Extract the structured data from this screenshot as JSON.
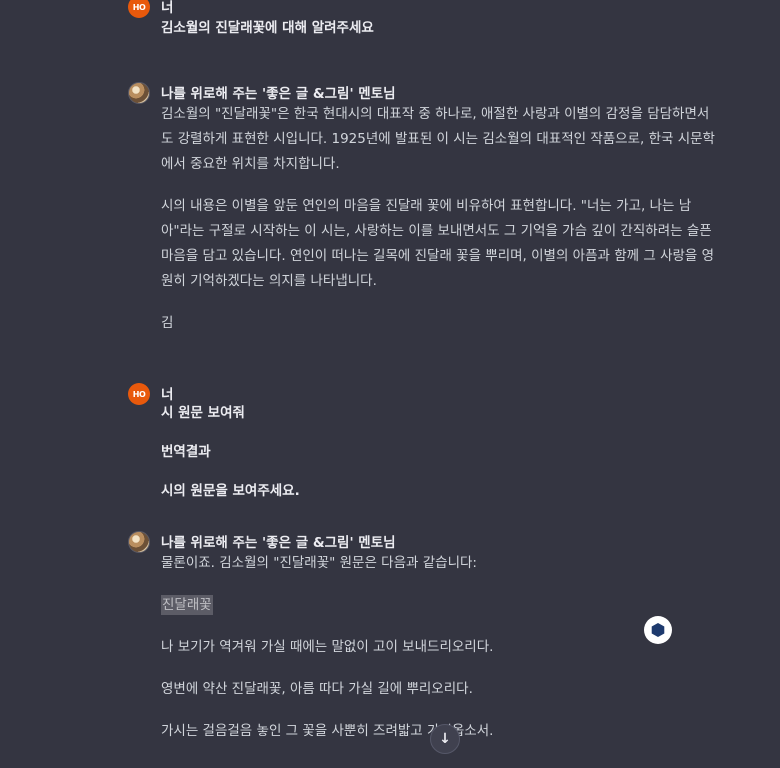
{
  "messages": [
    {
      "role": "user",
      "avatar": "HO",
      "author": "너",
      "paragraphs": [
        "김소월의 진달래꽃에 대해 알려주세요"
      ]
    },
    {
      "role": "assistant",
      "author": "나를 위로해 주는 '좋은 글 &그림' 멘토님",
      "paragraphs": [
        "김소월의 \"진달래꽃\"은 한국 현대시의 대표작 중 하나로, 애절한 사랑과 이별의 감정을 담담하면서도 강렬하게 표현한 시입니다. 1925년에 발표된 이 시는 김소월의 대표적인 작품으로, 한국 시문학에서 중요한 위치를 차지합니다.",
        "시의 내용은 이별을 앞둔 연인의 마음을 진달래 꽃에 비유하여 표현합니다. \"너는 가고, 나는 남아\"라는 구절로 시작하는 이 시는, 사랑하는 이를 보내면서도 그 기억을 가슴 깊이 간직하려는 슬픈 마음을 담고 있습니다. 연인이 떠나는 길목에 진달래 꽃을 뿌리며, 이별의 아픔과 함께 그 사랑을 영원히 기억하겠다는 의지를 나타냅니다.",
        "김"
      ]
    },
    {
      "role": "user",
      "avatar": "HO",
      "author": "너",
      "paragraphs": [
        "시 원문 보여줘",
        "번역결과",
        "시의 원문을 보여주세요."
      ]
    },
    {
      "role": "assistant",
      "author": "나를 위로해 주는 '좋은 글 &그림' 멘토님",
      "paragraphs": [
        "물론이죠. 김소월의 \"진달래꽃\" 원문은 다음과 같습니다:",
        "진달래꽃",
        "나 보기가 역겨워 가실 때에는 말없이 고이 보내드리오리다.",
        "영변에 약산 진달래꽃, 아름 따다 가실 길에 뿌리오리다.",
        "가시는 걸음걸음 놓인 그 꽃을 사뿐히 즈려밟고 가시옵소서."
      ]
    }
  ],
  "icons": {
    "floating": "extension-icon",
    "scroll": "arrow-down-icon"
  },
  "colors": {
    "background": "#343541",
    "user_avatar": "#e8590c"
  }
}
